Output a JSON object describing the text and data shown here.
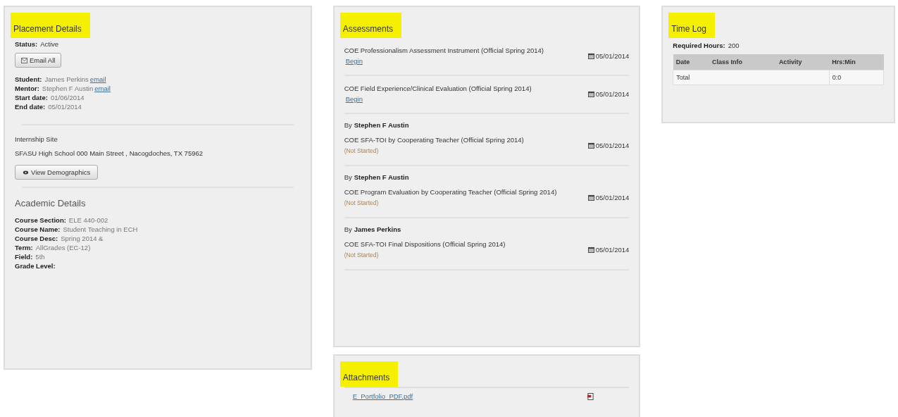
{
  "placement": {
    "title": "Placement Details",
    "highlighted": true,
    "status_label": "Status:",
    "status": "Active",
    "email_button": "Email All",
    "people": [
      {
        "label": "Student:",
        "value": "James Perkins",
        "link": "email"
      },
      {
        "label": "Mentor:",
        "value": "Stephen F Austin",
        "link": "email"
      },
      {
        "label": "Start date:",
        "value": "01/06/2014"
      },
      {
        "label": "End date:",
        "value": "05/01/2014"
      }
    ],
    "site_title": "Internship Site",
    "site_address": "SFASU High School 000 Main Street , Nacogdoches, TX 75962",
    "demographics_button": "View Demographics",
    "academic_title": "Academic Details",
    "academic": [
      {
        "label": "Course Section:",
        "value": "ELE 440-002"
      },
      {
        "label": "Course Name:",
        "value": "Student Teaching in ECH"
      },
      {
        "label": "Course Desc:",
        "value": "Spring 2014 &"
      },
      {
        "label": "Term:",
        "value": "AllGrades (EC-12)"
      },
      {
        "label": "Field:",
        "value": "5th"
      },
      {
        "label": "Grade Level:"
      }
    ]
  },
  "assessments": {
    "title": "Assessments",
    "highlighted": true,
    "items": [
      {
        "title": "COE Professionalism Assessment Instrument (Official Spring 2014)",
        "action": {
          "kind": "link",
          "text": "Begin"
        },
        "date": "05/01/2014"
      },
      {
        "title": "COE Field Experience/Clinical Evaluation (Official Spring 2014)",
        "action": {
          "kind": "link",
          "text": "Begin"
        },
        "date": "05/01/2014"
      },
      {
        "by_label": "By",
        "by": "Stephen F Austin",
        "title": "COE SFA-TOI by Cooperating Teacher (Official Spring 2014)",
        "action": {
          "kind": "status",
          "text": "(Not Started)"
        },
        "date": "05/01/2014"
      },
      {
        "by_label": "By",
        "by": "Stephen F Austin",
        "title": "COE Program Evaluation by Cooperating Teacher (Official Spring 2014)",
        "action": {
          "kind": "status",
          "text": "(Not Started)"
        },
        "date": "05/01/2014"
      },
      {
        "by_label": "By",
        "by": "James Perkins",
        "title": "COE SFA-TOI Final Dispositions (Official Spring 2014)",
        "action": {
          "kind": "status",
          "text": "(Not Started)"
        },
        "date": "05/01/2014"
      }
    ]
  },
  "attachments": {
    "title": "Attachments",
    "highlighted": true,
    "files": [
      {
        "name": "E_Portfolio_PDF.pdf"
      }
    ]
  },
  "time_log": {
    "title": "Time Log",
    "highlighted": true,
    "required_label": "Required Hours:",
    "required": "200",
    "table": {
      "columns": [
        "Date",
        "Class Info",
        "Activity",
        "Hrs:Min"
      ],
      "rows": [
        {
          "label": "Total",
          "value": "0:0"
        }
      ]
    }
  }
}
